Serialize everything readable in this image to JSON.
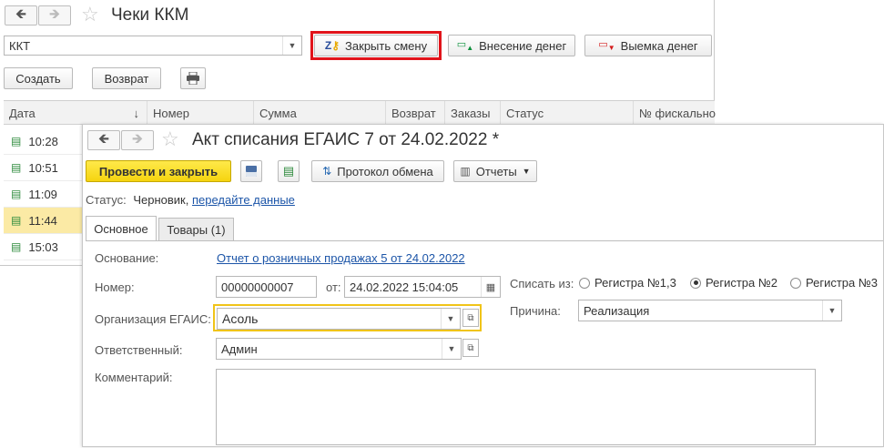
{
  "back_window": {
    "title": "Чеки ККМ",
    "kkt_value": "ККТ",
    "close_shift_label": "Закрыть смену",
    "deposit_label": "Внесение денег",
    "withdraw_label": "Выемка денег",
    "create_label": "Создать",
    "return_label": "Возврат",
    "table": {
      "columns": [
        "Дата",
        "Номер",
        "Сумма",
        "Возврат",
        "Заказы",
        "Статус",
        "№ фискально"
      ],
      "sort_indicator": "↓",
      "rows": [
        "10:28",
        "10:51",
        "11:09",
        "11:44",
        "15:03"
      ],
      "selected_index": 3
    },
    "accent_highlight": "#e1141b"
  },
  "doc_window": {
    "title": "Акт списания ЕГАИС 7 от 24.02.2022 *",
    "post_close_label": "Провести и закрыть",
    "exchange_log_label": "Протокол обмена",
    "reports_label": "Отчеты",
    "status_label": "Статус:",
    "status_value": "Черновик,",
    "status_link": "передайте данные",
    "tabs": [
      {
        "label": "Основное",
        "active": true
      },
      {
        "label": "Товары (1)",
        "active": false
      }
    ],
    "form": {
      "basis_label": "Основание:",
      "basis_value": "Отчет о розничных продажах 5 от 24.02.2022",
      "number_label": "Номер:",
      "number_value": "00000000007",
      "from_label": "от:",
      "date_value": "24.02.2022 15:04:05",
      "writeoff_label": "Списать из:",
      "writeoff_options": [
        "Регистра №1,3",
        "Регистра №2",
        "Регистра №3"
      ],
      "writeoff_selected": 1,
      "org_label": "Организация ЕГАИС:",
      "org_value": "Асоль",
      "reason_label": "Причина:",
      "reason_value": "Реализация",
      "responsible_label": "Ответственный:",
      "responsible_value": "Админ",
      "comment_label": "Комментарий:",
      "comment_value": ""
    },
    "accent_yellow": "#f5d40f",
    "focus_border": "#f0c419"
  }
}
